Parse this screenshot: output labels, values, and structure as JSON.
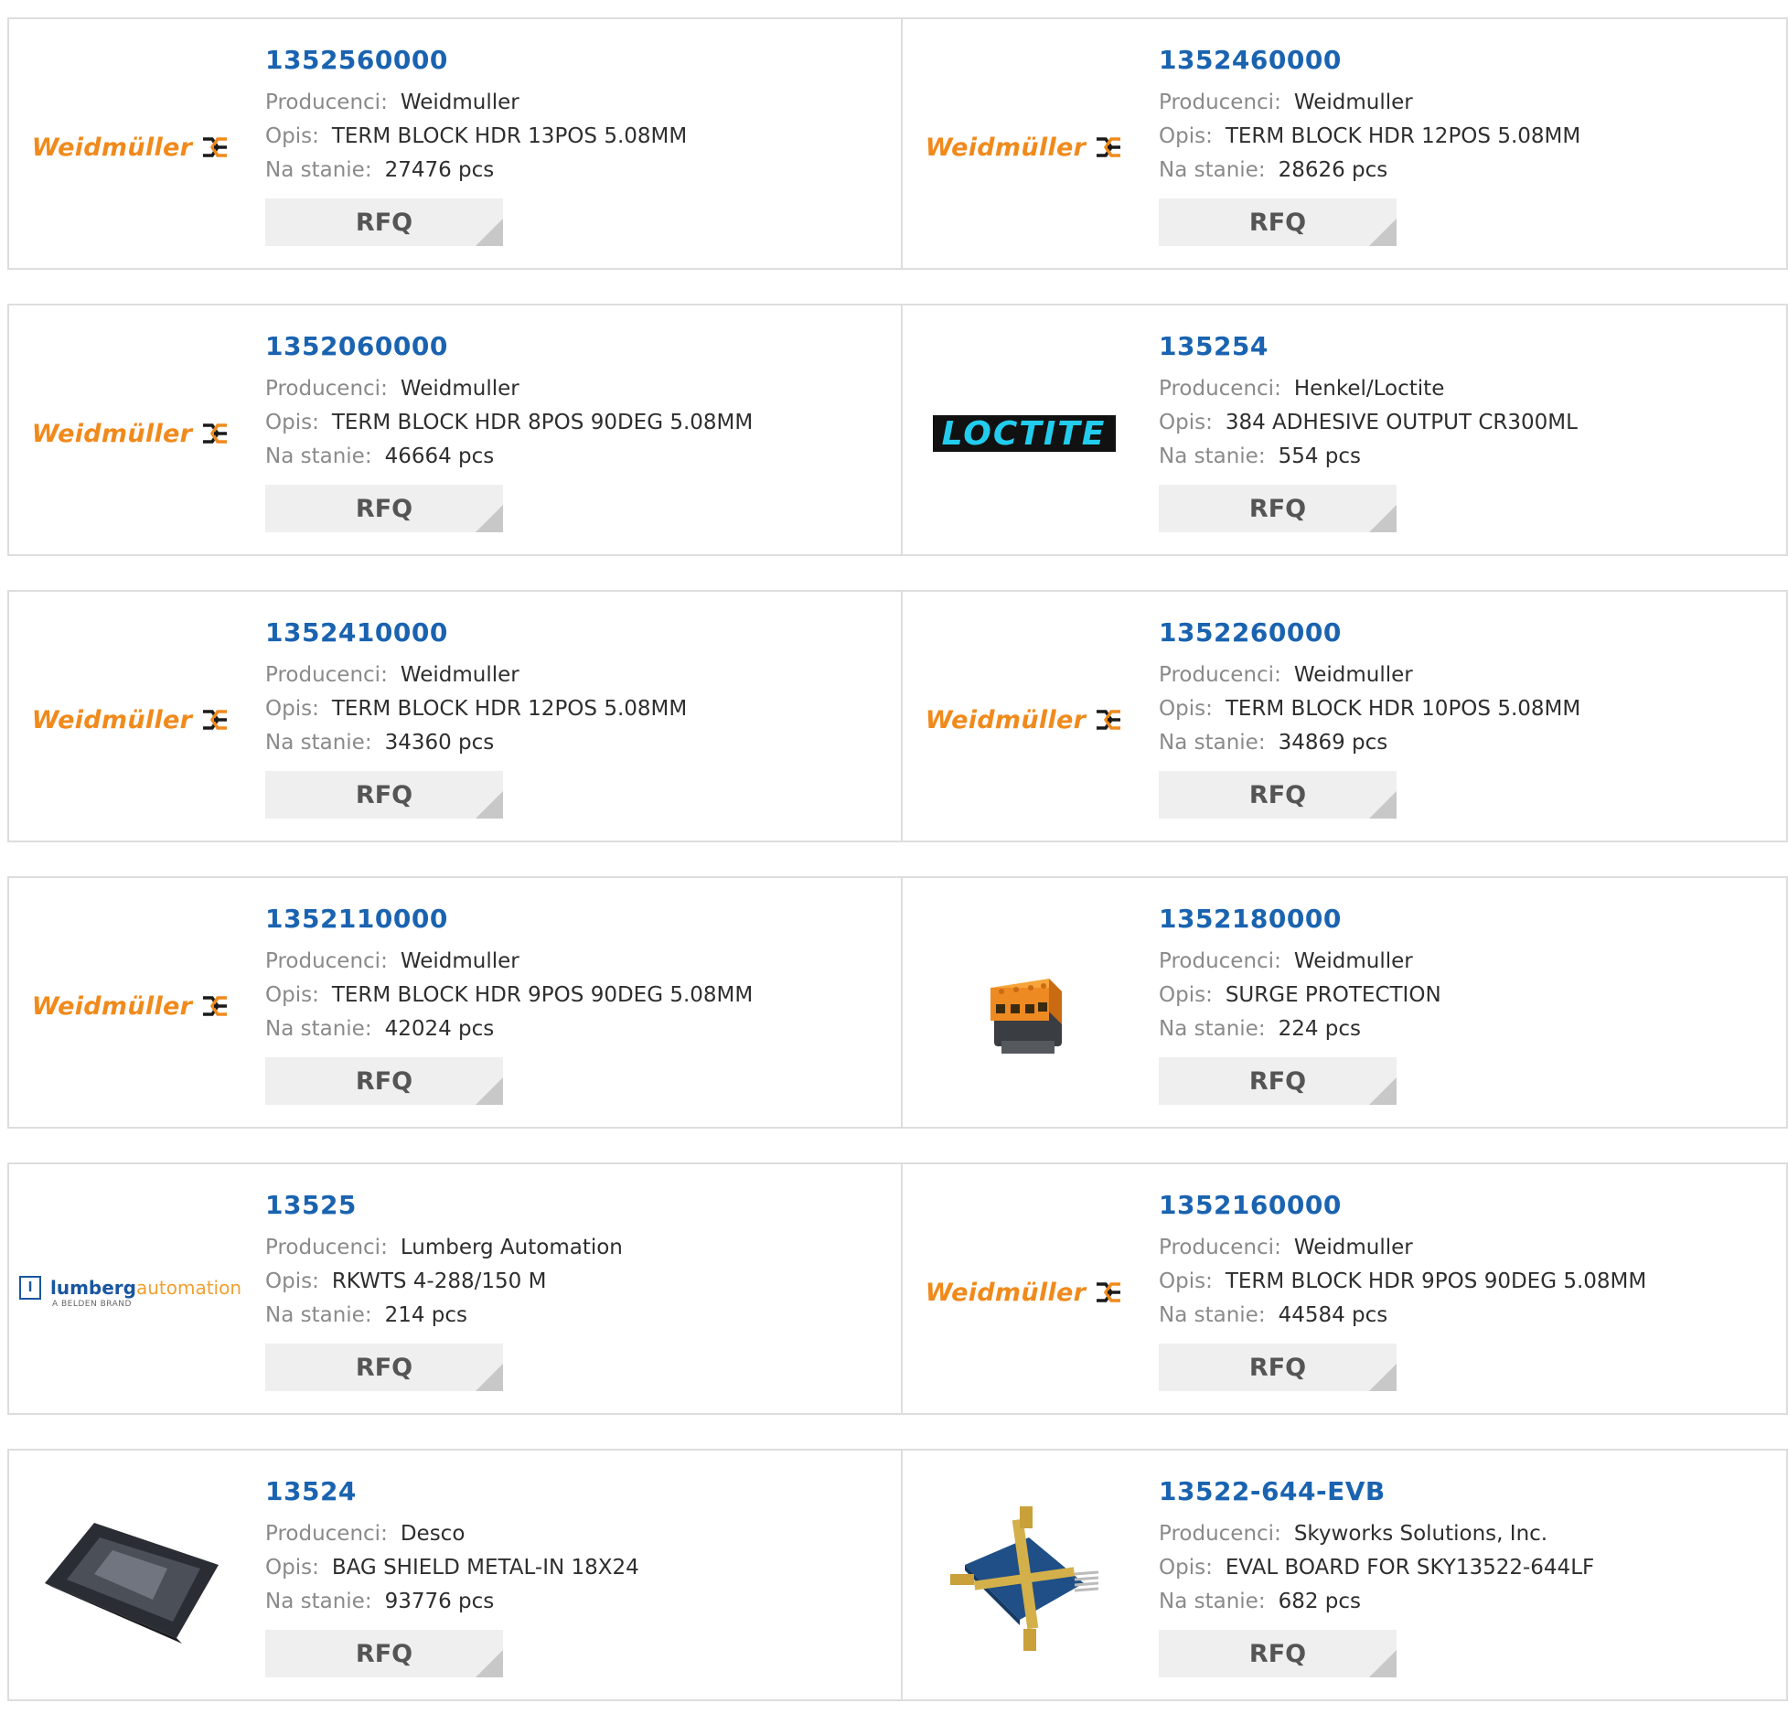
{
  "labels": {
    "manufacturer": "Producenci:",
    "description": "Opis:",
    "stock": "Na stanie:",
    "rfq": "RFQ"
  },
  "products": [
    {
      "pn": "1352560000",
      "manufacturer": "Weidmuller",
      "description": "TERM BLOCK HDR 13POS 5.08MM",
      "stock": "27476 pcs",
      "logo": "weidmuller-logo",
      "logo_text": "Weidmüller"
    },
    {
      "pn": "1352460000",
      "manufacturer": "Weidmuller",
      "description": "TERM BLOCK HDR 12POS 5.08MM",
      "stock": "28626 pcs",
      "logo": "weidmuller-logo",
      "logo_text": "Weidmüller"
    },
    {
      "pn": "1352060000",
      "manufacturer": "Weidmuller",
      "description": "TERM BLOCK HDR 8POS 90DEG 5.08MM",
      "stock": "46664 pcs",
      "logo": "weidmuller-logo",
      "logo_text": "Weidmüller"
    },
    {
      "pn": "135254",
      "manufacturer": "Henkel/Loctite",
      "description": "384 ADHESIVE OUTPUT CR300ML",
      "stock": "554 pcs",
      "logo": "loctite-logo",
      "logo_text": "LOCTITE"
    },
    {
      "pn": "1352410000",
      "manufacturer": "Weidmuller",
      "description": "TERM BLOCK HDR 12POS 5.08MM",
      "stock": "34360 pcs",
      "logo": "weidmuller-logo",
      "logo_text": "Weidmüller"
    },
    {
      "pn": "1352260000",
      "manufacturer": "Weidmuller",
      "description": "TERM BLOCK HDR 10POS 5.08MM",
      "stock": "34869 pcs",
      "logo": "weidmuller-logo",
      "logo_text": "Weidmüller"
    },
    {
      "pn": "1352110000",
      "manufacturer": "Weidmuller",
      "description": "TERM BLOCK HDR 9POS 90DEG 5.08MM",
      "stock": "42024 pcs",
      "logo": "weidmuller-logo",
      "logo_text": "Weidmüller"
    },
    {
      "pn": "1352180000",
      "manufacturer": "Weidmuller",
      "description": "SURGE PROTECTION",
      "stock": "224 pcs",
      "logo": "surge-protector-photo",
      "logo_text": ""
    },
    {
      "pn": "13525",
      "manufacturer": "Lumberg Automation",
      "description": "RKWTS 4-288/150 M",
      "stock": "214 pcs",
      "logo": "lumberg-logo",
      "logo_text": "lumberg",
      "logo_text2": "automation",
      "logo_sub": "A BELDEN BRAND"
    },
    {
      "pn": "1352160000",
      "manufacturer": "Weidmuller",
      "description": "TERM BLOCK HDR 9POS 90DEG 5.08MM",
      "stock": "44584 pcs",
      "logo": "weidmuller-logo",
      "logo_text": "Weidmüller"
    },
    {
      "pn": "13524",
      "manufacturer": "Desco",
      "description": "BAG SHIELD METAL-IN 18X24",
      "stock": "93776 pcs",
      "logo": "shield-bag-photo",
      "logo_text": ""
    },
    {
      "pn": "13522-644-EVB",
      "manufacturer": "Skyworks Solutions, Inc.",
      "description": "EVAL BOARD FOR SKY13522-644LF",
      "stock": "682 pcs",
      "logo": "eval-board-photo",
      "logo_text": ""
    }
  ],
  "colors": {
    "link": "#1a63b0",
    "weidmuller": "#f08a1c",
    "loctite": "#22ccee"
  }
}
